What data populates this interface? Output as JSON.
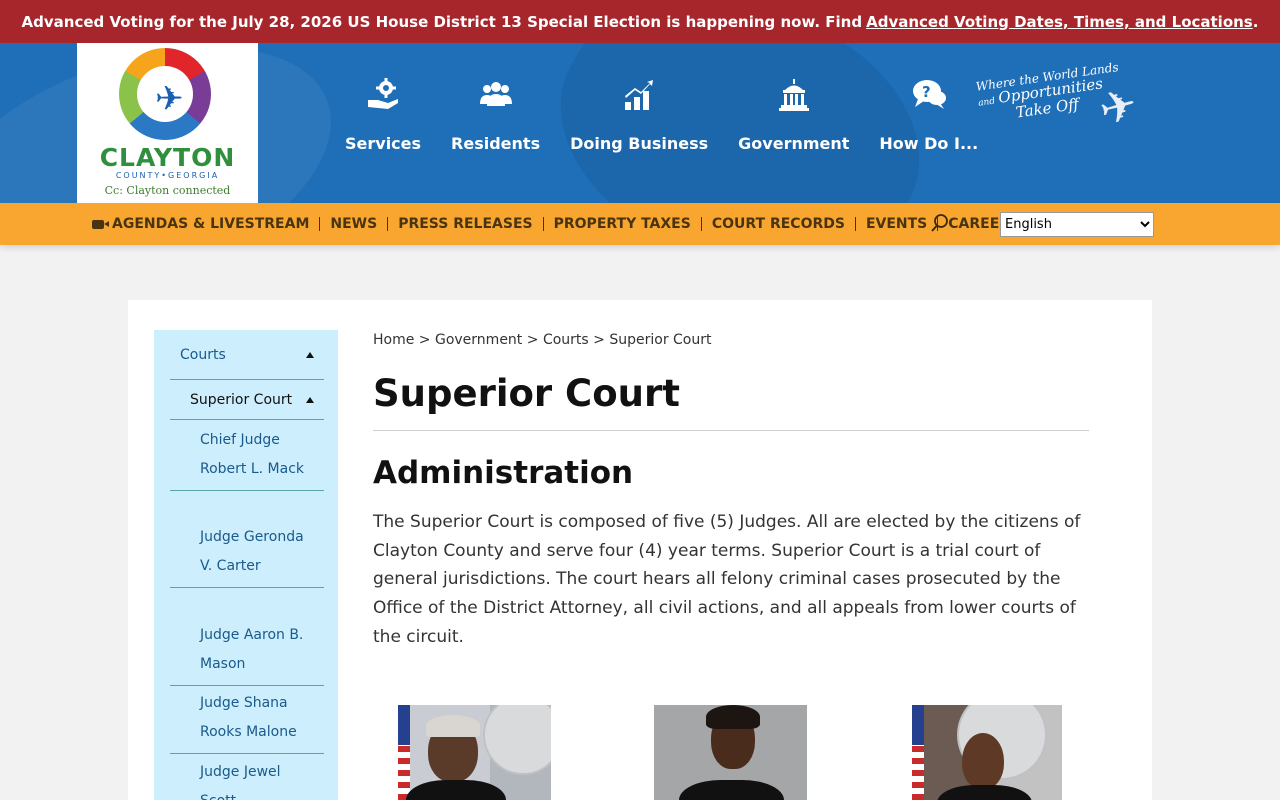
{
  "alert": {
    "text": "Advanced Voting for the July 28, 2026 US House District 13 Special Election is happening now. Find",
    "link": "Advanced Voting Dates, Times, and Locations",
    "suffix": "."
  },
  "logo": {
    "brand": "CLAYTON",
    "sub": "COUNTY•GEORGIA",
    "tagline": "Cc: Clayton connected"
  },
  "main_nav": [
    {
      "label": "Services",
      "icon": "gear-hand-icon"
    },
    {
      "label": "Residents",
      "icon": "people-icon"
    },
    {
      "label": "Doing Business",
      "icon": "chart-growth-icon"
    },
    {
      "label": "Government",
      "icon": "capitol-building-icon"
    },
    {
      "label": "How Do I...",
      "icon": "question-bubble-icon"
    }
  ],
  "slogan": {
    "line1": "Where the World Lands",
    "line2_small": "and",
    "line2_big": "Opportunities",
    "line3": "Take Off"
  },
  "utility_nav": [
    {
      "label": "AGENDAS & LIVESTREAM",
      "icon": "video-camera-icon"
    },
    {
      "label": "NEWS"
    },
    {
      "label": "PRESS RELEASES"
    },
    {
      "label": "PROPERTY TAXES"
    },
    {
      "label": "COURT RECORDS"
    },
    {
      "label": "EVENTS"
    },
    {
      "label": "CAREERS"
    }
  ],
  "language": {
    "selected": "English"
  },
  "sidebar": {
    "top": "Courts",
    "sub": "Superior Court",
    "items": [
      "Chief Judge Robert L. Mack",
      "Judge Geronda V. Carter",
      "Judge Aaron B. Mason",
      "Judge Shana Rooks Malone",
      "Judge Jewel Scott"
    ]
  },
  "breadcrumb": {
    "home": "Home",
    "government": "Government",
    "courts": "Courts",
    "current": "Superior Court",
    "sep": ">"
  },
  "page": {
    "title": "Superior Court",
    "section_title": "Administration",
    "body": "The Superior Court is composed of five (5) Judges. All are elected by the citizens of Clayton County and serve four (4) year terms. Superior Court is a trial court of general jurisdictions. The court hears all felony criminal cases prosecuted by the Office of the District Attorney, all civil actions, and all appeals from lower courts of the circuit."
  },
  "colors": {
    "alert_bg": "#a6262c",
    "header_bg": "#1f6fb8",
    "utility_bg": "#f8a630",
    "sidebar_bg": "#cdeefc"
  }
}
